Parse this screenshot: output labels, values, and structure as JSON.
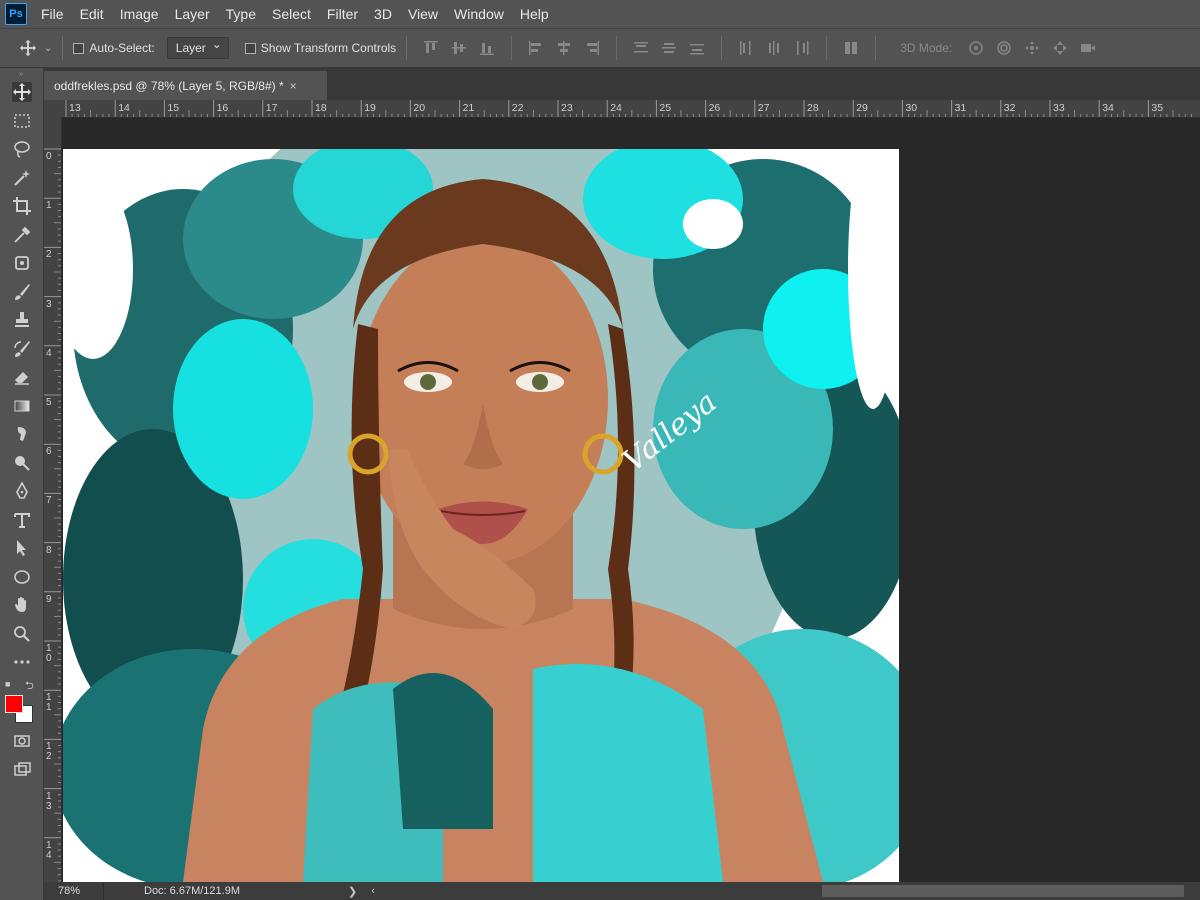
{
  "app": {
    "logo_text": "Ps"
  },
  "menu": [
    "File",
    "Edit",
    "Image",
    "Layer",
    "Type",
    "Select",
    "Filter",
    "3D",
    "View",
    "Window",
    "Help"
  ],
  "options": {
    "auto_select_label": "Auto-Select:",
    "auto_select_value": "Layer",
    "show_transform_label": "Show Transform Controls",
    "mode3d_label": "3D Mode:"
  },
  "document": {
    "tab_title": "oddfrekles.psd @ 78% (Layer 5, RGB/8#) *",
    "close_glyph": "×"
  },
  "rulers": {
    "horizontal": [
      "13",
      "14",
      "15",
      "16",
      "17",
      "18",
      "19",
      "20",
      "21",
      "22",
      "23",
      "24",
      "25",
      "26",
      "27",
      "28",
      "29",
      "30",
      "31",
      "32",
      "33",
      "34",
      "35"
    ],
    "vertical": [
      "0",
      "1",
      "2",
      "3",
      "4",
      "5",
      "6",
      "7",
      "8",
      "9",
      "10",
      "11",
      "12",
      "13",
      "14"
    ]
  },
  "canvas": {
    "signature": "Valleya"
  },
  "status": {
    "zoom": "78%",
    "doc_info": "Doc: 6.67M/121.9M",
    "arrow": "❯",
    "arrow_left": "‹"
  },
  "colors": {
    "foreground": "#ff0000",
    "background": "#ffffff",
    "ui_panel": "#535353",
    "workspace": "#282828",
    "accent_ps": "#31a8ff"
  },
  "tools": [
    "move-tool",
    "marquee-tool",
    "lasso-tool",
    "magic-wand-tool",
    "crop-tool",
    "eyedropper-tool",
    "patch-tool",
    "brush-tool",
    "stamp-tool",
    "history-brush-tool",
    "eraser-tool",
    "gradient-tool",
    "smudge-tool",
    "dodge-tool",
    "pen-tool",
    "type-tool",
    "path-selection-tool",
    "ellipse-tool",
    "hand-tool",
    "zoom-tool",
    "more-tools"
  ]
}
